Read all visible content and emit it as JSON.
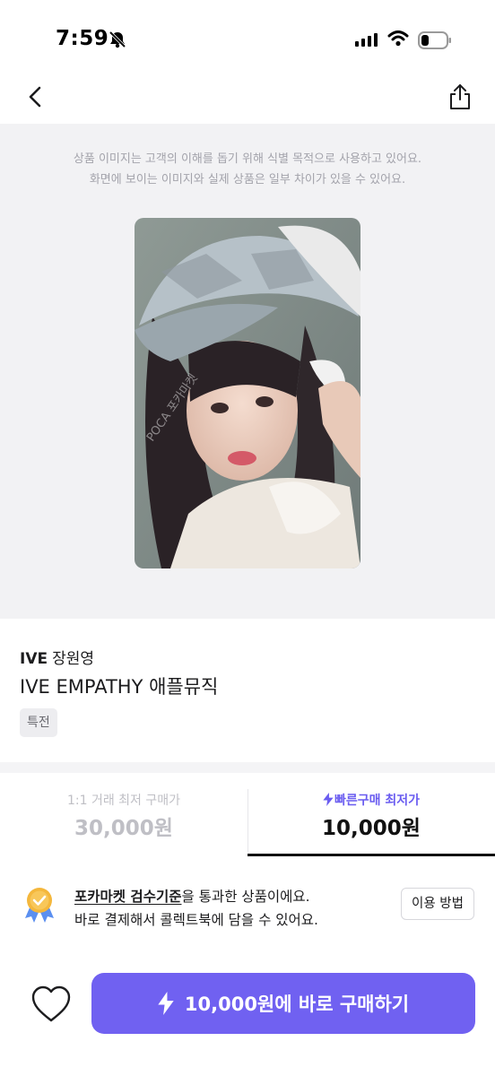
{
  "status_bar": {
    "time": "7:59",
    "icons": [
      "bell-slash-icon",
      "signal-icon",
      "wifi-icon",
      "battery-icon"
    ]
  },
  "nav": {
    "back_icon": "chevron-left-icon",
    "share_icon": "share-icon"
  },
  "image_section": {
    "disclaimer_line1": "상품 이미지는 고객의 이해를 돕기 위해 식별 목적으로 사용하고 있어요.",
    "disclaimer_line2": "화면에 보이는 이미지와 실제 상품은 일부 차이가 있을 수 있어요.",
    "watermark": "POCA 포카마켓"
  },
  "product": {
    "group": "IVE",
    "member": "장원영",
    "title": "IVE EMPATHY 애플뮤직",
    "tag": "특전"
  },
  "price_tabs": {
    "left": {
      "label": "1:1 거래 최저 구매가",
      "value": "30,000원"
    },
    "right": {
      "label": "빠른구매 최저가",
      "value": "10,000원",
      "icon": "lightning-icon"
    }
  },
  "notice": {
    "link_text": "포카마켓 검수기준",
    "line1_rest": "을 통과한 상품이에요.",
    "line2": "바로 결제해서 콜렉트북에 담을 수 있어요.",
    "button": "이용 방법",
    "icon": "medal-icon"
  },
  "bottom": {
    "heart_icon": "heart-icon",
    "buy_button": "10,000원에 바로 구매하기",
    "buy_icon": "lightning-icon"
  },
  "colors": {
    "accent": "#7061f1",
    "image_bg": "#f2f2f4",
    "muted_text": "#bfbfc5",
    "medal_gold": "#f4b73c",
    "medal_ribbon": "#5b8ff0"
  }
}
